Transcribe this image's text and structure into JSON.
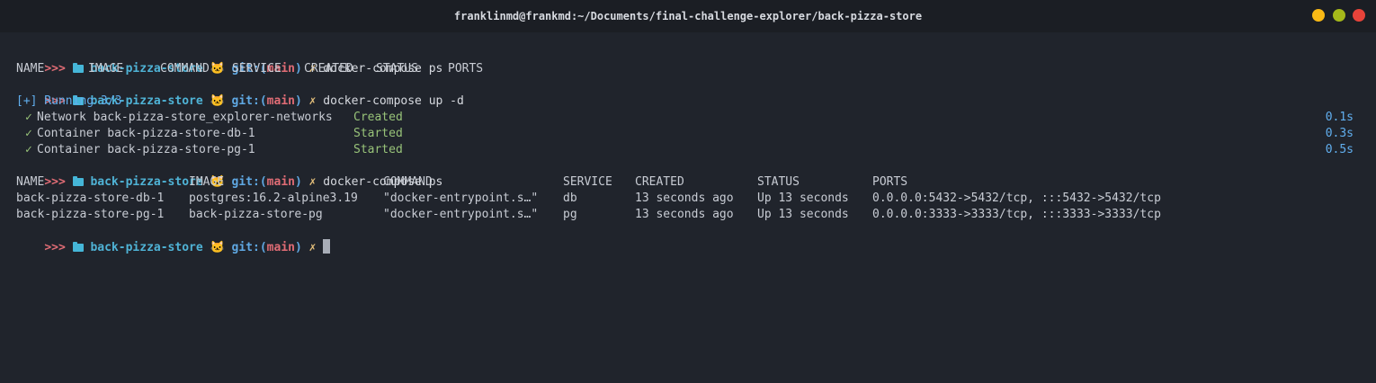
{
  "window": {
    "title": "franklinmd@frankmd:~/Documents/final-challenge-explorer/back-pizza-store",
    "colors": {
      "minimize": "#f9b915",
      "maximize": "#a5b81a",
      "close": "#e8433a"
    }
  },
  "prompt": {
    "arrows": ">>>",
    "dir": "back-pizza-store",
    "git_label": "git:(",
    "branch": "main",
    "git_close": ")",
    "mark": "✗"
  },
  "commands": {
    "ps1": "docker-compose ps",
    "up": "docker-compose up -d",
    "ps2": "docker-compose ps"
  },
  "ps_empty_header": [
    "NAME",
    "IMAGE",
    "COMMAND",
    "SERVICE",
    "CREATED",
    "STATUS",
    "PORTS"
  ],
  "up_output": {
    "running": "[+] Running 3/3",
    "items": [
      {
        "check": "✓",
        "text": "Network back-pizza-store_explorer-networks",
        "state": "Created",
        "time": "0.1s"
      },
      {
        "check": "✓",
        "text": "Container back-pizza-store-db-1",
        "state": "Started",
        "time": "0.3s"
      },
      {
        "check": "✓",
        "text": "Container back-pizza-store-pg-1",
        "state": "Started",
        "time": "0.5s"
      }
    ]
  },
  "ps_table": {
    "headers": [
      "NAME",
      "IMAGE",
      "COMMAND",
      "SERVICE",
      "CREATED",
      "STATUS",
      "PORTS"
    ],
    "rows": [
      [
        "back-pizza-store-db-1",
        "postgres:16.2-alpine3.19",
        "\"docker-entrypoint.s…\"",
        "db",
        "13 seconds ago",
        "Up 13 seconds",
        "0.0.0.0:5432->5432/tcp, :::5432->5432/tcp"
      ],
      [
        "back-pizza-store-pg-1",
        "back-pizza-store-pg",
        "\"docker-entrypoint.s…\"",
        "pg",
        "13 seconds ago",
        "Up 13 seconds",
        "0.0.0.0:3333->3333/tcp, :::3333->3333/tcp"
      ]
    ]
  }
}
